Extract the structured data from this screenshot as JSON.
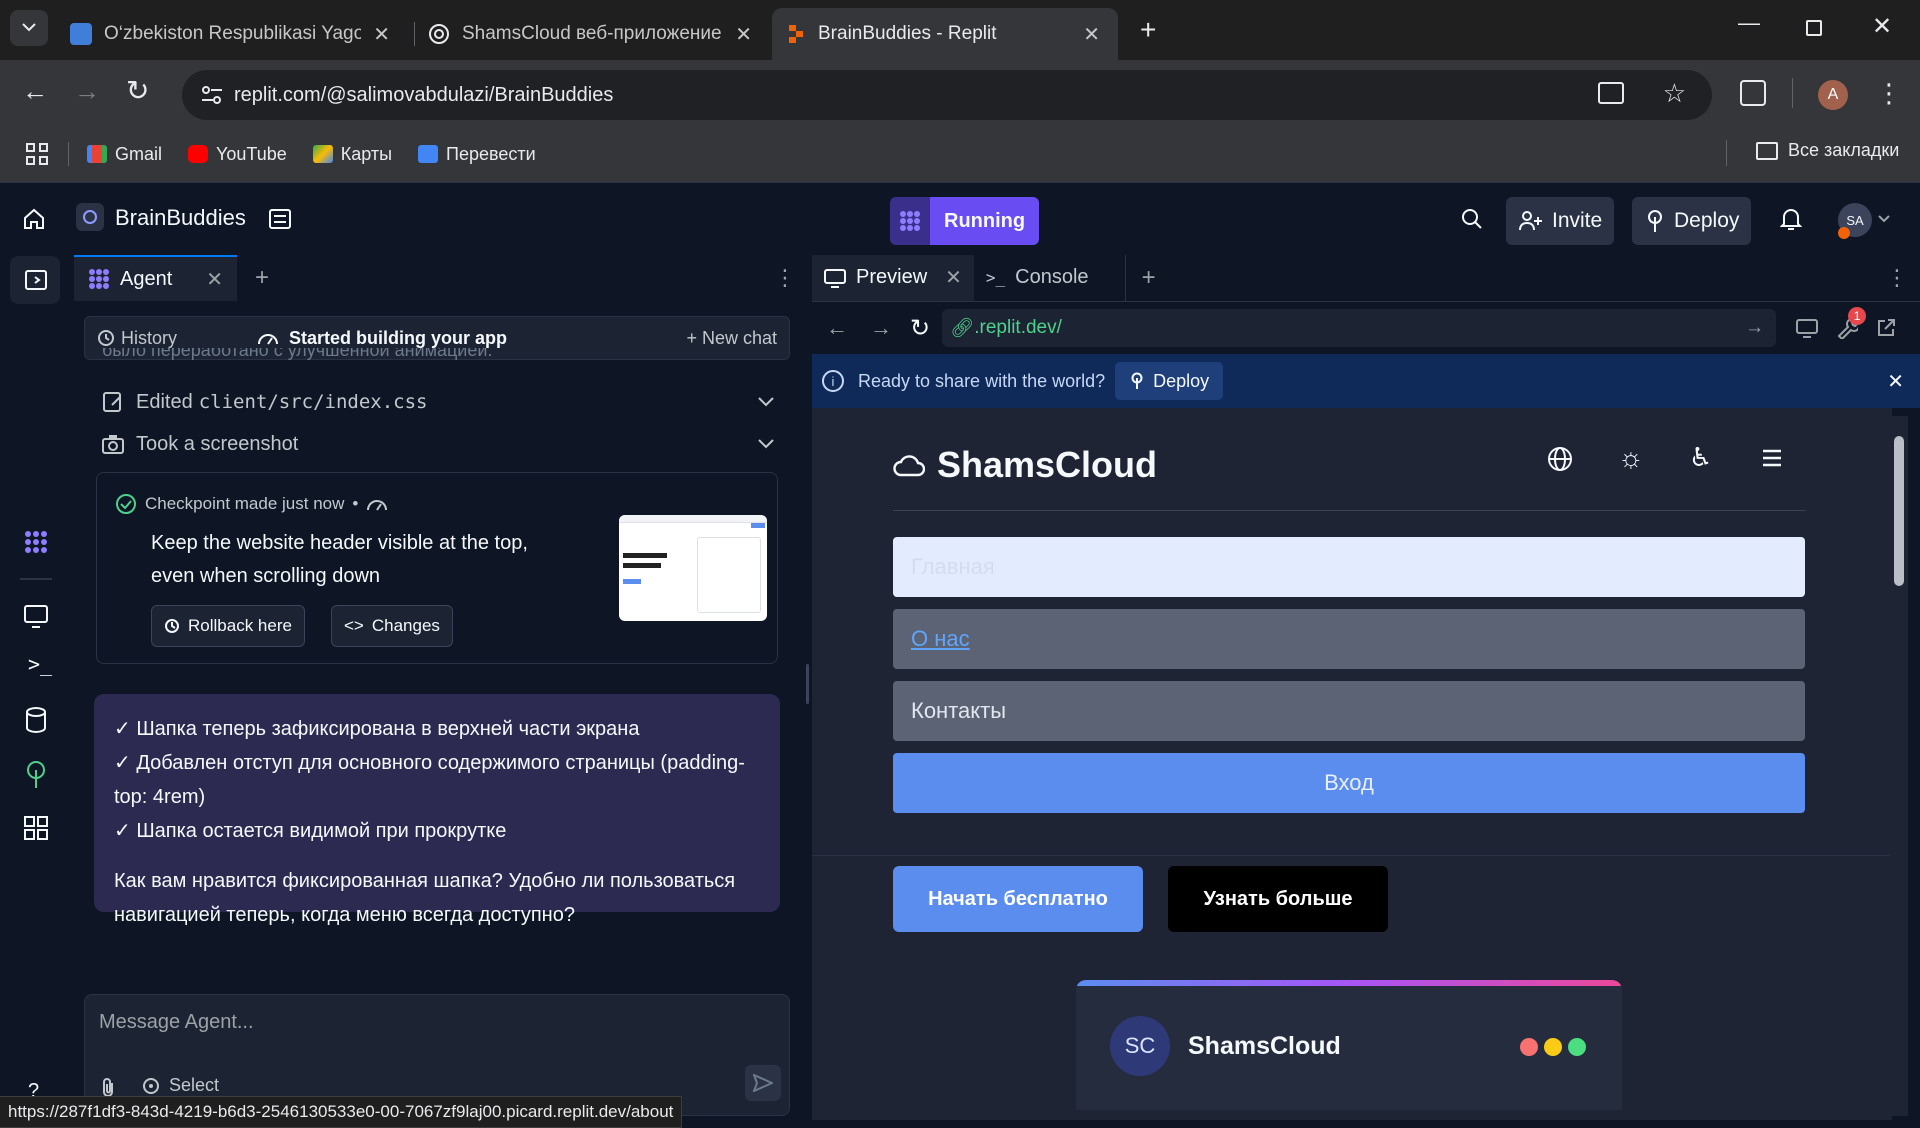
{
  "browser": {
    "tabs": [
      {
        "title": "O‘zbekiston Respublikasi Yagona"
      },
      {
        "title": "ShamsCloud веб-приложение"
      },
      {
        "title": "BrainBuddies - Replit"
      }
    ],
    "url": "replit.com/@salimovabdulazi/BrainBuddies",
    "profile_initial": "A",
    "bookmarks": [
      "Gmail",
      "YouTube",
      "Карты",
      "Перевести"
    ],
    "all_bookmarks": "Все закладки",
    "status_url": "https://287f1df3-843d-4219-b6d3-2546130533e0-00-7067zf9laj00.picard.replit.dev/about"
  },
  "replit": {
    "project_name": "BrainBuddies",
    "run_status": "Running",
    "invite": "Invite",
    "deploy": "Deploy",
    "avatar": "SA",
    "agent_tab": "Agent",
    "history": "History",
    "session_title": "Started building your app",
    "new_chat": "+ New chat",
    "cut_text": "было переработано с улучшенной анимацией.",
    "actions": [
      {
        "label": "Edited ",
        "code": "client/src/index.css"
      },
      {
        "label": "Took a screenshot",
        "code": ""
      }
    ],
    "checkpoint": {
      "label": "Checkpoint made just now",
      "text": "Keep the website header visible at the top, even when scrolling down",
      "rollback": "Rollback here",
      "changes": "Changes"
    },
    "message": {
      "lines": [
        "✓ Шапка теперь зафиксирована в верхней части экрана",
        "✓ Добавлен отступ для основного содержимого страницы (padding-top: 4rem)",
        "✓ Шапка остается видимой при прокрутке"
      ],
      "question": "Как вам нравится фиксированная шапка? Удобно ли пользоваться навигацией теперь, когда меню всегда доступно?"
    },
    "input_placeholder": "Message Agent...",
    "select": "Select",
    "preview_tab": "Preview",
    "console_tab": "Console",
    "preview_url": ".replit.dev/",
    "wrench_badge": "1",
    "share_banner": "Ready to share with the world?",
    "share_deploy": "Deploy"
  },
  "site": {
    "brand": "ShamsCloud",
    "nav": {
      "home": "Главная",
      "about": "О нас",
      "contacts": "Контакты",
      "login": "Вход"
    },
    "cta_primary": "Начать бесплатно",
    "cta_secondary": "Узнать больше",
    "card_initials": "SC",
    "card_title": "ShamsCloud"
  }
}
